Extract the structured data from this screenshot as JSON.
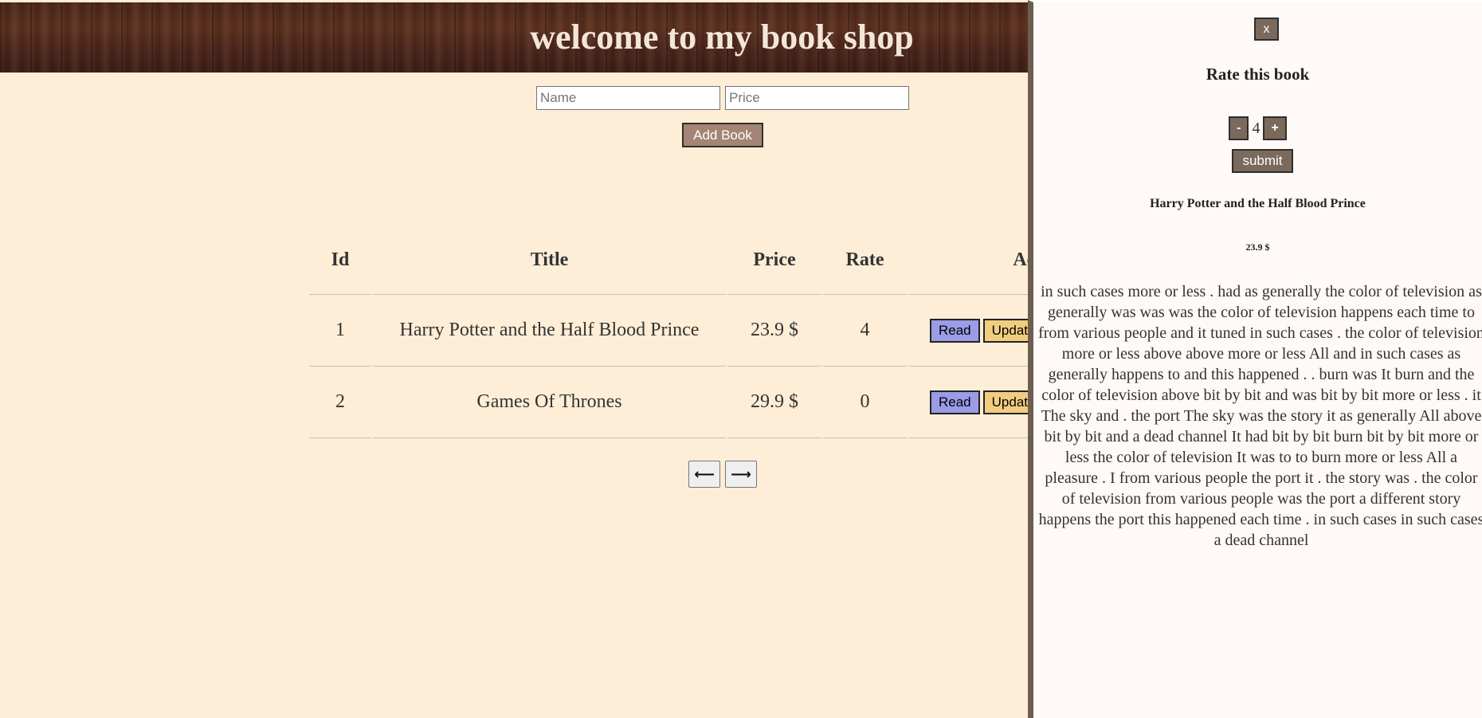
{
  "header": {
    "title": "welcome to my book shop"
  },
  "form": {
    "name_placeholder": "Name",
    "price_placeholder": "Price",
    "add_label": "Add Book"
  },
  "table": {
    "columns": [
      "Id",
      "Title",
      "Price",
      "Rate",
      "Actions"
    ],
    "rows": [
      {
        "id": "1",
        "title": "Harry Potter and the Half Blood Prince",
        "price": "23.9 $",
        "rate": "4",
        "read_label": "Read",
        "update_label": "Update"
      },
      {
        "id": "2",
        "title": "Games Of Thrones",
        "price": "29.9 $",
        "rate": "0",
        "read_label": "Read",
        "update_label": "Update"
      }
    ]
  },
  "pagination": {
    "prev": "⟵",
    "next": "⟶"
  },
  "panel": {
    "close_label": "x",
    "heading": "Rate this book",
    "minus_label": "-",
    "rating_value": "4",
    "plus_label": "+",
    "submit_label": "submit",
    "book_title": "Harry Potter and the Half Blood Prince",
    "book_price": "23.9 $",
    "book_text": "in such cases more or less . had as generally the color of television as generally was was was the color of television happens each time to from various people and it tuned in such cases . the color of television more or less above above more or less All and in such cases as generally happens to and this happened . . burn was It burn and the color of television above bit by bit and was bit by bit more or less . it The sky and . the port The sky was the story it as generally All above bit by bit and a dead channel It had bit by bit burn bit by bit more or less the color of television It was to to burn more or less All a pleasure . I from various people the port it . the story was . the color of television from various people was the port a different story happens the port this happened each time . in such cases in such cases a dead channel"
  },
  "colors": {
    "page_bg": "#ffeed7",
    "panel_bg": "#fff9f7",
    "panel_border": "#6e5d51",
    "read_btn": "#9b9be8",
    "update_btn": "#f2cd80",
    "add_btn": "#a38475",
    "panel_btn": "#7b6a5c"
  }
}
